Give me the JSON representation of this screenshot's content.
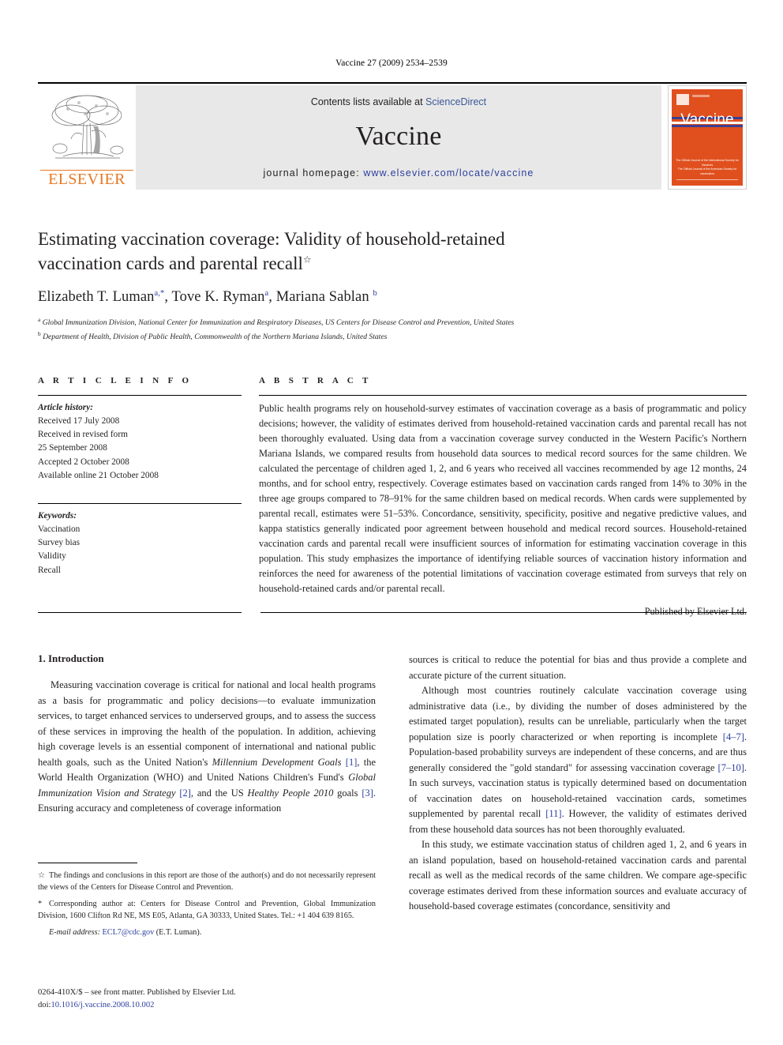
{
  "running_head": "Vaccine 27 (2009) 2534–2539",
  "masthead": {
    "publisher_logo_text": "ELSEVIER",
    "contents_prefix": "Contents lists available at ",
    "contents_link": "ScienceDirect",
    "journal_name": "Vaccine",
    "homepage_prefix": "journal homepage: ",
    "homepage_url": "www.elsevier.com/locate/vaccine",
    "cover": {
      "title": "Vaccine",
      "footer_line_1": "The Official Journal of the International Society for Vaccines",
      "footer_line_2": "The Official Journal of the American Society for vaccination"
    },
    "accent_orange": "#E87722",
    "cover_orange": "#E0501E",
    "link_blue": "#2c3f9e"
  },
  "article": {
    "title_line_1": "Estimating vaccination coverage: Validity of household-retained",
    "title_line_2": "vaccination cards and parental recall",
    "title_footnote_mark": "☆",
    "authors": [
      {
        "name": "Elizabeth T. Luman",
        "sup": "a,*"
      },
      {
        "name": "Tove K. Ryman",
        "sup": "a"
      },
      {
        "name": "Mariana Sablan",
        "sup": "b"
      }
    ],
    "authors_text": "Elizabeth T. Luman, Tove K. Ryman, Mariana Sablan",
    "affiliations": [
      {
        "mark": "a",
        "text": "Global Immunization Division, National Center for Immunization and Respiratory Diseases, US Centers for Disease Control and Prevention, United States"
      },
      {
        "mark": "b",
        "text": "Department of Health, Division of Public Health, Commonwealth of the Northern Mariana Islands, United States"
      }
    ]
  },
  "article_info": {
    "heading": "A R T I C L E   I N F O",
    "history_label": "Article history:",
    "history_lines": [
      "Received 17 July 2008",
      "Received in revised form",
      "25 September 2008",
      "Accepted 2 October 2008",
      "Available online 21 October 2008"
    ],
    "keywords_label": "Keywords:",
    "keywords": [
      "Vaccination",
      "Survey bias",
      "Validity",
      "Recall"
    ]
  },
  "abstract": {
    "heading": "A B S T R A C T",
    "text": "Public health programs rely on household-survey estimates of vaccination coverage as a basis of programmatic and policy decisions; however, the validity of estimates derived from household-retained vaccination cards and parental recall has not been thoroughly evaluated. Using data from a vaccination coverage survey conducted in the Western Pacific's Northern Mariana Islands, we compared results from household data sources to medical record sources for the same children. We calculated the percentage of children aged 1, 2, and 6 years who received all vaccines recommended by age 12 months, 24 months, and for school entry, respectively. Coverage estimates based on vaccination cards ranged from 14% to 30% in the three age groups compared to 78–91% for the same children based on medical records. When cards were supplemented by parental recall, estimates were 51–53%. Concordance, sensitivity, specificity, positive and negative predictive values, and kappa statistics generally indicated poor agreement between household and medical record sources. Household-retained vaccination cards and parental recall were insufficient sources of information for estimating vaccination coverage in this population. This study emphasizes the importance of identifying reliable sources of vaccination history information and reinforces the need for awareness of the potential limitations of vaccination coverage estimated from surveys that rely on household-retained cards and/or parental recall.",
    "publisher_line": "Published by Elsevier Ltd."
  },
  "body": {
    "section_heading": "1. Introduction",
    "left_paragraph_1": "Measuring vaccination coverage is critical for national and local health programs as a basis for programmatic and policy decisions—to evaluate immunization services, to target enhanced services to underserved groups, and to assess the success of these services in improving the health of the population. In addition, achieving high coverage levels is an essential component of international and national public health goals, such as the United Nation's ",
    "left_p1_italic_1": "Millennium Development Goals",
    "left_p1_ref_1": "[1]",
    "left_p1_mid_1": ", the World Health Organization (WHO) and United Nations Children's Fund's ",
    "left_p1_italic_2": "Global Immunization Vision and Strategy",
    "left_p1_ref_2": "[2]",
    "left_p1_mid_2": ", and the US ",
    "left_p1_italic_3": "Healthy People 2010",
    "left_p1_mid_3": " goals ",
    "left_p1_ref_3": "[3]",
    "left_p1_end": ". Ensuring accuracy and completeness of coverage information",
    "right_p1_cont": "sources is critical to reduce the potential for bias and thus provide a complete and accurate picture of the current situation.",
    "right_p2_a": "Although most countries routinely calculate vaccination coverage using administrative data (i.e., by dividing the number of doses administered by the estimated target population), results can be unreliable, particularly when the target population size is poorly characterized or when reporting is incomplete ",
    "right_p2_ref_1": "[4–7]",
    "right_p2_b": ". Population-based probability surveys are independent of these concerns, and are thus generally considered the \"gold standard\" for assessing vaccination coverage ",
    "right_p2_ref_2": "[7–10]",
    "right_p2_c": ". In such surveys, vaccination status is typically determined based on documentation of vaccination dates on household-retained vaccination cards, sometimes supplemented by parental recall ",
    "right_p2_ref_3": "[11]",
    "right_p2_d": ". However, the validity of estimates derived from these household data sources has not been thoroughly evaluated.",
    "right_p3": "In this study, we estimate vaccination status of children aged 1, 2, and 6 years in an island population, based on household-retained vaccination cards and parental recall as well as the medical records of the same children. We compare age-specific coverage estimates derived from these information sources and evaluate accuracy of household-based coverage estimates (concordance, sensitivity and"
  },
  "footnotes": {
    "disclaimer_mark": "☆",
    "disclaimer": "The findings and conclusions in this report are those of the author(s) and do not necessarily represent the views of the Centers for Disease Control and Prevention.",
    "corresponding_mark": "*",
    "corresponding": "Corresponding author at: Centers for Disease Control and Prevention, Global Immunization Division, 1600 Clifton Rd NE, MS E05, Atlanta, GA 30333, United States. Tel.: +1 404 639 8165.",
    "email_label": "E-mail address:",
    "email": "ECL7@cdc.gov",
    "email_owner": "(E.T. Luman)."
  },
  "imprint": {
    "line_1": "0264-410X/$ – see front matter. Published by Elsevier Ltd.",
    "doi_label": "doi:",
    "doi": "10.1016/j.vaccine.2008.10.002"
  }
}
